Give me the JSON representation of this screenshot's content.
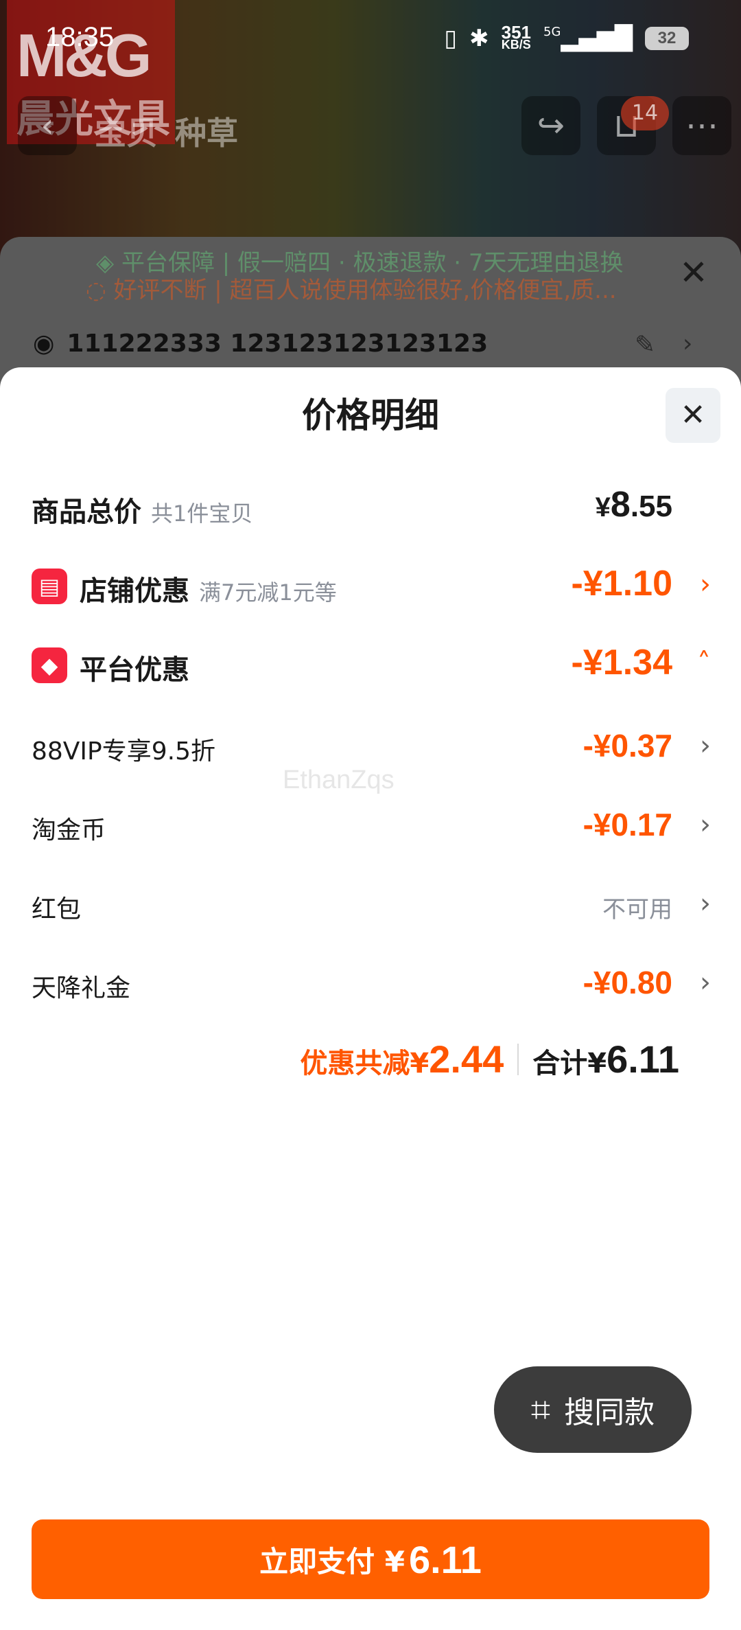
{
  "status_bar": {
    "time": "18:35",
    "net_speed_value": "351",
    "net_speed_unit": "KB/S",
    "signal_label": "5G",
    "battery": "32"
  },
  "background": {
    "brand_mark": "M&G",
    "brand_cn": "晨光文具",
    "tabs": [
      "宝贝",
      "种草"
    ],
    "cart_count": "14",
    "guarantee": "平台保障 | 假一赔四 · 极速退款 · 7天无理由退换",
    "review": "好评不断 | 超百人说使用体验很好,价格便宜,质...",
    "address": "111222333 123123123123123"
  },
  "sheet": {
    "title": "价格明细",
    "total_label": "商品总价",
    "total_sub": "共1件宝贝",
    "total_yen": "¥",
    "total_int": "8",
    "total_dec": ".55",
    "shop_label": "店铺优惠",
    "shop_sub": "满7元减1元等",
    "shop_amount": "-¥1.10",
    "platform_label": "平台优惠",
    "platform_amount": "-¥1.34",
    "items": [
      {
        "label": "88VIP专享9.5折",
        "amount": "-¥0.37"
      },
      {
        "label": "淘金币",
        "amount": "-¥0.17"
      },
      {
        "label": "红包",
        "amount": "不可用"
      },
      {
        "label": "天降礼金",
        "amount": "-¥0.80"
      }
    ],
    "watermark": "EthanZqs",
    "discount_prefix": "优惠共减¥",
    "discount_value": "2.44",
    "subtotal_prefix": "合计¥",
    "subtotal_value": "6.11"
  },
  "float_button": {
    "label": "搜同款",
    "icon": "scan-icon"
  },
  "pay_button": {
    "label": "立即支付 ¥",
    "amount": "6.11"
  },
  "colors": {
    "accent": "#ff5500",
    "pay": "#ff6000",
    "tag": "#f5253f"
  }
}
